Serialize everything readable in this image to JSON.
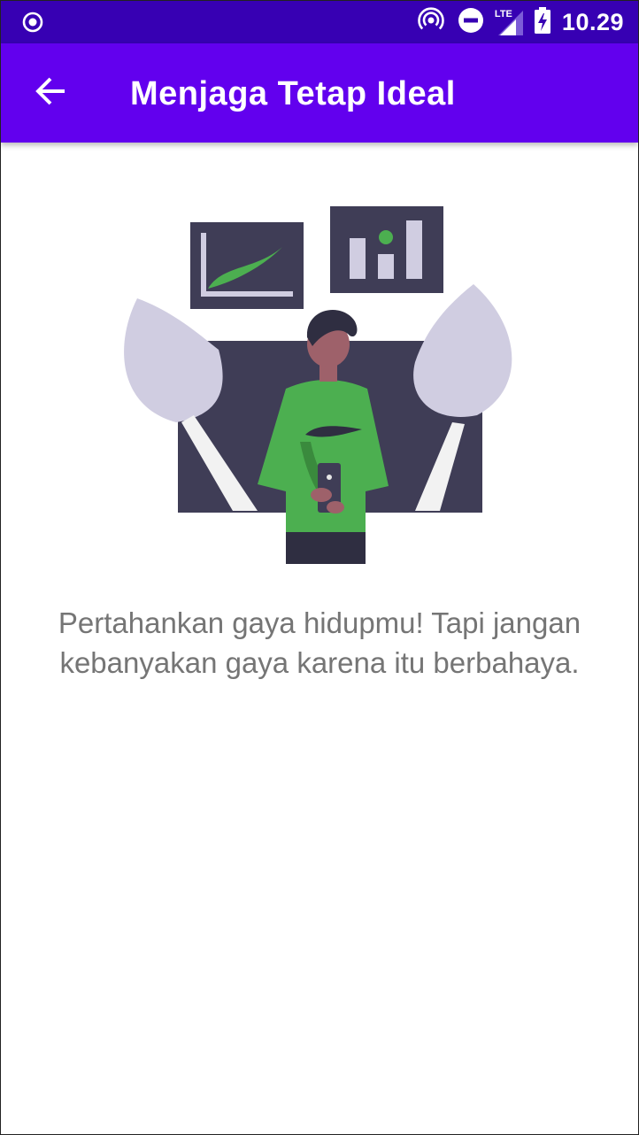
{
  "status_bar": {
    "time": "10.29",
    "network_label": "LTE"
  },
  "app_bar": {
    "title": "Menjaga Tetap Ideal",
    "back_icon": "arrow-back-icon"
  },
  "content": {
    "message_lines": [
      "Pertahankan gaya hidupmu! Tapi jangan",
      "kebanyakan gaya karena itu berbahaya."
    ]
  },
  "colors": {
    "status_bar": "#3700b3",
    "app_bar": "#6200ee",
    "accent_green": "#4caf50",
    "dark_panel": "#3f3d56",
    "leaf": "#d0cde1",
    "message_text": "#757575"
  }
}
